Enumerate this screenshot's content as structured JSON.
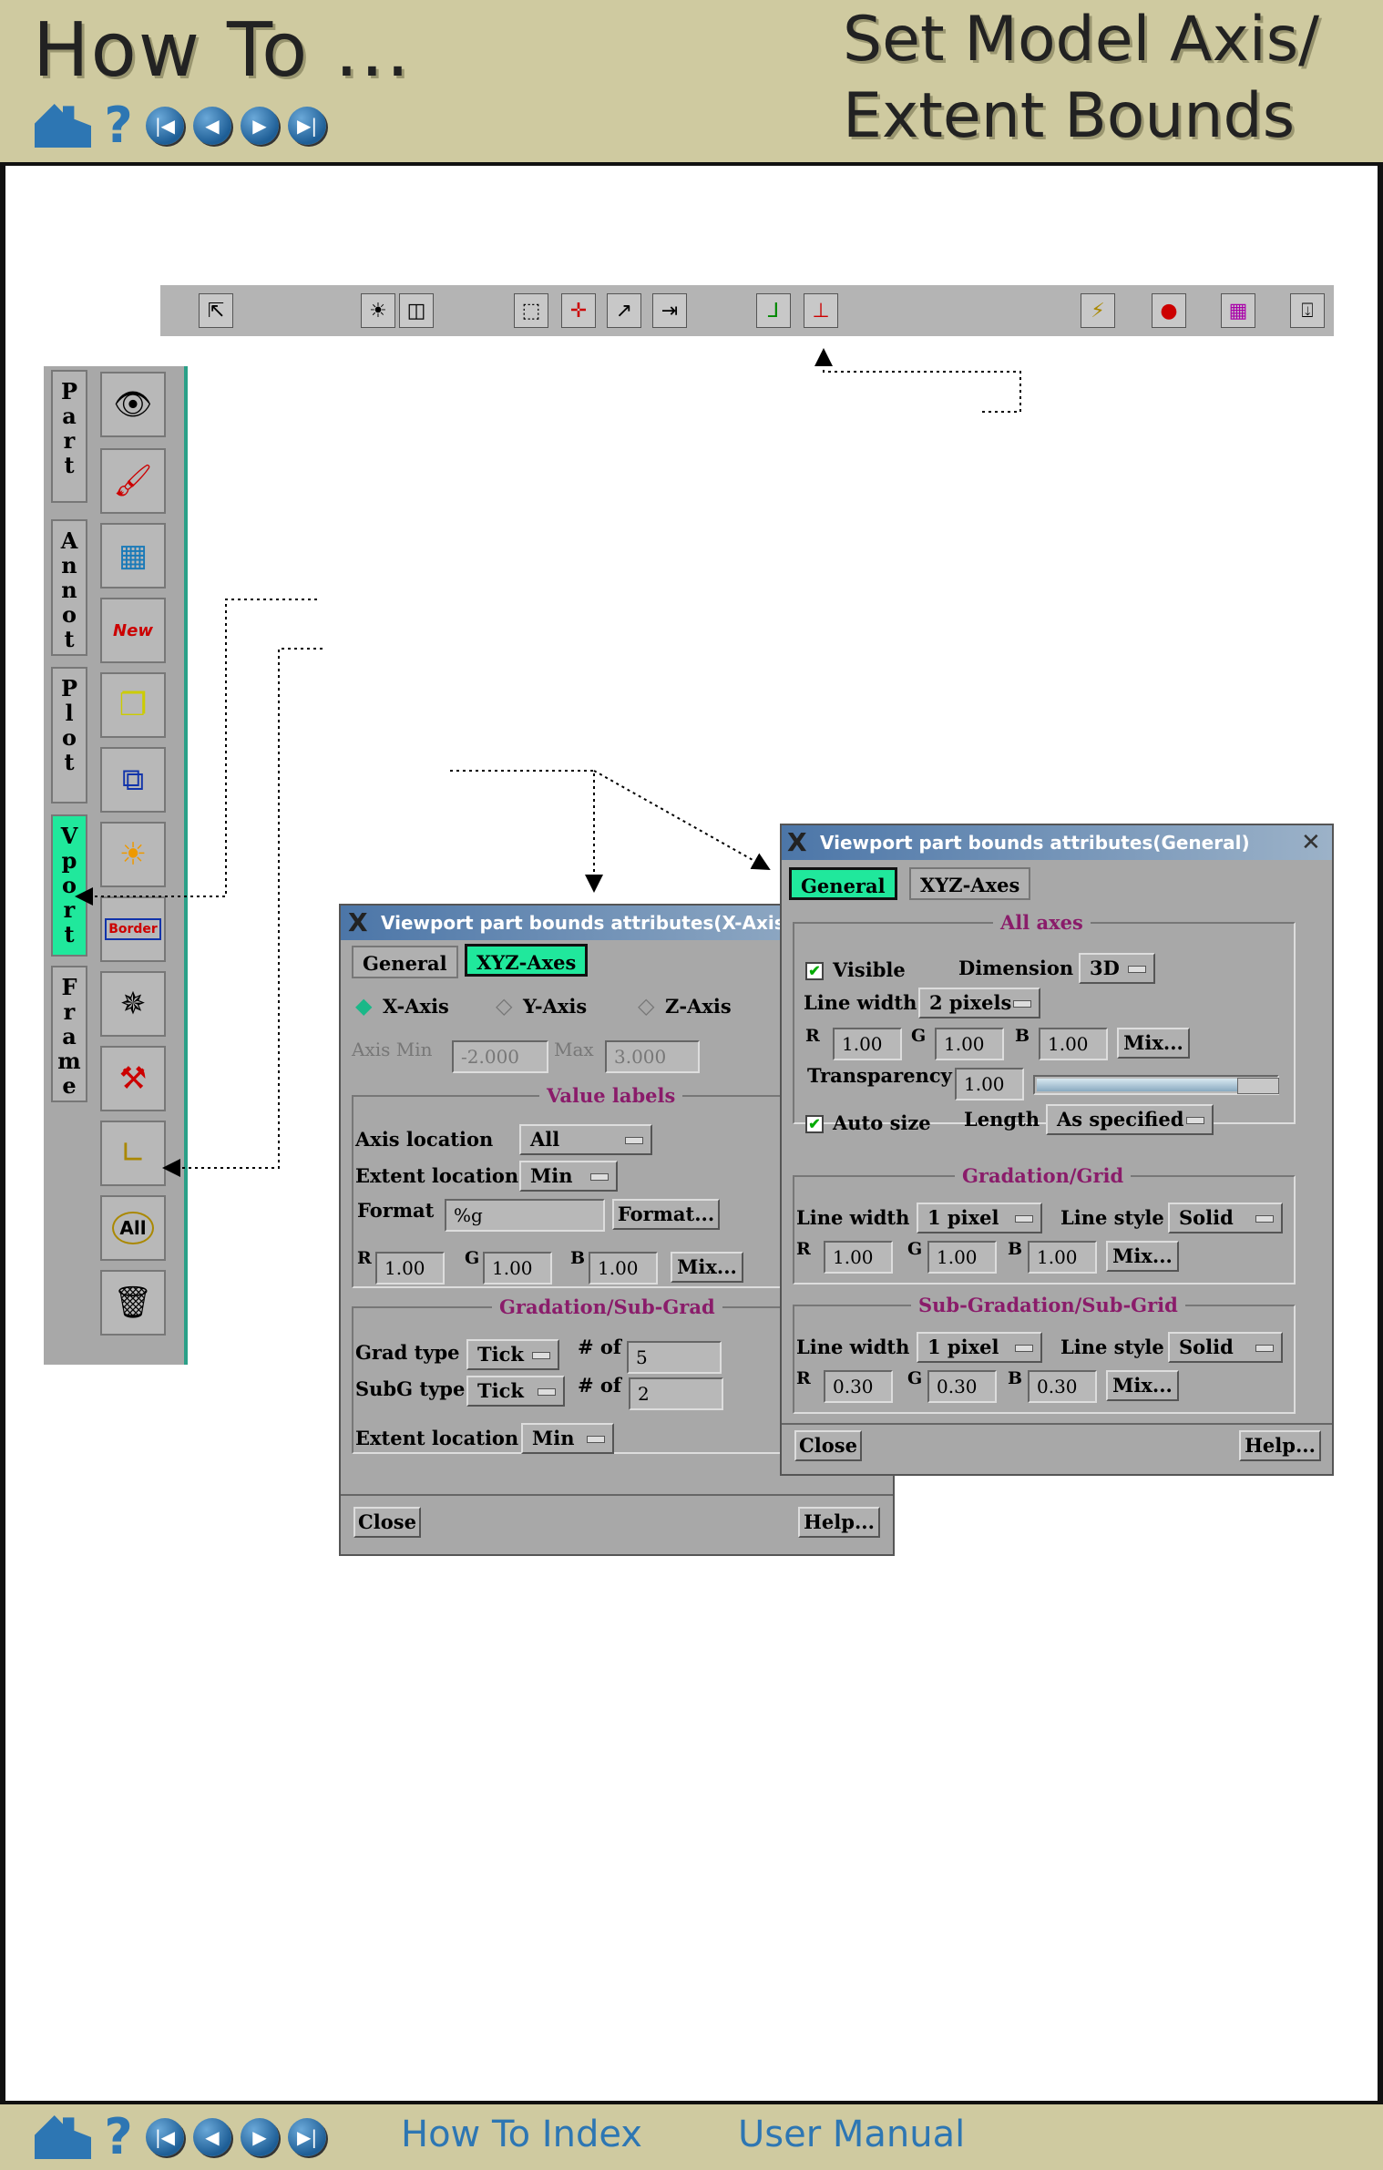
{
  "header": {
    "how_to": "How To ...",
    "title_line1": "Set Model Axis/",
    "title_line2": "Extent Bounds",
    "nav": {
      "home": "home-icon",
      "help": "?",
      "first": "|◀",
      "prev": "◀",
      "next": "▶",
      "last": "▶|"
    }
  },
  "footer": {
    "index_link": "How To Index",
    "manual_link": "User Manual"
  },
  "toolbar": {
    "icons": [
      "pick-icon",
      "light-icon",
      "box-icon",
      "zoom-icon",
      "axis-icon",
      "arrow-icon",
      "flip-icon",
      "axis-triad-icon",
      "extent-bounds-icon",
      "lightning-icon",
      "record-icon",
      "palette-icon",
      "query-icon"
    ]
  },
  "tool_panel": {
    "tabs": [
      {
        "label": "P\na\nr\nt",
        "active": false
      },
      {
        "label": "A\nn\nn\no\nt",
        "active": false
      },
      {
        "label": "P\nl\no\nt",
        "active": false
      },
      {
        "label": "V\np\no\nr\nt",
        "active": true
      },
      {
        "label": "F\nr\na\nm\ne",
        "active": false
      }
    ],
    "icons": [
      "eye-icon",
      "paint-icon",
      "viewport-grid-icon",
      "new-icon",
      "copy-icon",
      "stack-icon",
      "lighting-icon",
      "border-icon",
      "compass-icon",
      "tools-icon",
      "ruler-icon",
      "all-icon",
      "trash-icon"
    ],
    "all_label": "All",
    "new_label": "New",
    "border_label": "Border"
  },
  "dialog_x": {
    "title": "Viewport part bounds attributes(X-Axis)",
    "tab_general": "General",
    "tab_xyz": "XYZ-Axes",
    "x_axis": "X-Axis",
    "y_axis": "Y-Axis",
    "z_axis": "Z-Axis",
    "axis_min_label": "Axis Min",
    "axis_min": "-2.000",
    "max_label": "Max",
    "max": "3.000",
    "value_labels": "Value labels",
    "axis_location_label": "Axis location",
    "axis_location": "All",
    "extent_location_label": "Extent location",
    "extent_location": "Min",
    "format_label": "Format",
    "format": "%g",
    "format_btn": "Format...",
    "r_label": "R",
    "r": "1.00",
    "g_label": "G",
    "g": "1.00",
    "b_label": "B",
    "b": "1.00",
    "mix": "Mix...",
    "grad_section": "Gradation/Sub-Grad",
    "grad_type_label": "Grad type",
    "grad_type": "Tick",
    "num_of_label": "# of",
    "grad_num": "5",
    "subg_type_label": "SubG type",
    "subg_type": "Tick",
    "subg_num": "2",
    "extent_location2_label": "Extent location",
    "extent_location2": "Min",
    "close": "Close",
    "help": "Help..."
  },
  "dialog_g": {
    "title": "Viewport part bounds attributes(General)",
    "tab_general": "General",
    "tab_xyz": "XYZ-Axes",
    "all_axes": "All axes",
    "visible_label": "Visible",
    "visible_checked": true,
    "dimension_label": "Dimension",
    "dimension": "3D",
    "line_width_label": "Line width",
    "line_width": "2 pixels",
    "r_label": "R",
    "r": "1.00",
    "g_label": "G",
    "g": "1.00",
    "b_label": "B",
    "b": "1.00",
    "mix": "Mix...",
    "transparency_label": "Transparency",
    "transparency": "1.00",
    "transparency_level": 1.0,
    "auto_size_label": "Auto size",
    "auto_size_checked": true,
    "length_label": "Length",
    "length": "As specified",
    "grad_section": "Gradation/Grid",
    "grad_line_width": "1 pixel",
    "line_style_label": "Line style",
    "grad_line_style": "Solid",
    "grad_r": "1.00",
    "grad_g": "1.00",
    "grad_b": "1.00",
    "sub_section": "Sub-Gradation/Sub-Grid",
    "sub_line_width": "1 pixel",
    "sub_line_style": "Solid",
    "sub_r": "0.30",
    "sub_g": "0.30",
    "sub_b": "0.30",
    "close": "Close",
    "help": "Help..."
  },
  "colors": {
    "header_bg": "#cfcaa0",
    "active_tab": "#20e89c",
    "section_title": "#8a1c6a",
    "nav_blue": "#2d76b3"
  }
}
